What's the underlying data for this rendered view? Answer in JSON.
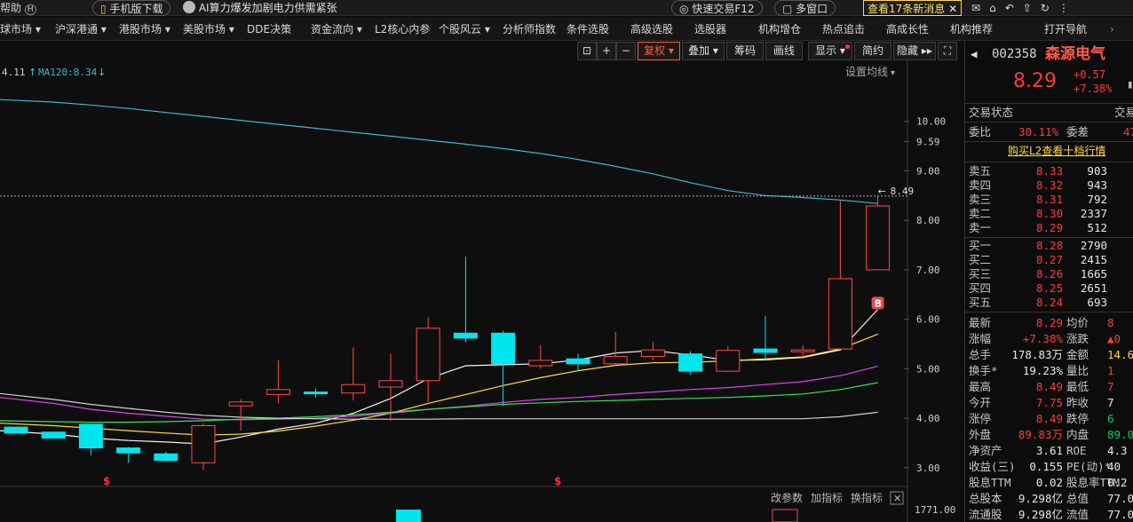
{
  "topbar": {
    "help": "帮助",
    "help_key": "H",
    "mobile": "手机版下载",
    "news": "AI算力爆发加剧电力供需紧张",
    "quick_trade": "快速交易F12",
    "multi_window": "多窗口",
    "news_count": "查看17条新消息"
  },
  "menu": [
    "球市场 ▾",
    "沪深港通 ▾",
    "港股市场 ▾",
    "美股市场 ▾",
    "DDE决策",
    "资金流向 ▾",
    "L2核心内参",
    "个股风云 ▾",
    "分析师指数",
    "条件选股",
    "高级选股",
    "选股器",
    "机构增仓",
    "热点追击",
    "高成长性",
    "机构推荐",
    "打开导航"
  ],
  "toolbar": {
    "fuquan": "复权",
    "overlay": "叠加",
    "chips": "筹码",
    "draw": "画线",
    "display": "显示",
    "simple": "简约",
    "hide": "隐藏"
  },
  "chart": {
    "ma_legend_prefix": "4.11",
    "ma120_label": "MA120:8.34",
    "settings_label": "设置均线",
    "price_ticks": [
      "10.00",
      "9.59",
      "9.00",
      "8.00",
      "7.00",
      "6.00",
      "5.00",
      "4.00",
      "3.00"
    ],
    "high_marker": "8.49",
    "buy_marker": "B",
    "div_marker": "$",
    "volume_axis": "1771.00",
    "indicator_buttons": [
      "改参数",
      "加指标",
      "换指标"
    ],
    "colors": {
      "up": "#ff4a4a",
      "down": "#00e5ee",
      "ma120": "#3fb7c9"
    }
  },
  "chart_data": {
    "type": "candlestick",
    "ylim": [
      2.8,
      10.3
    ],
    "candles": [
      {
        "o": 3.82,
        "h": 3.82,
        "l": 3.7,
        "c": 3.7
      },
      {
        "o": 3.72,
        "h": 3.72,
        "l": 3.6,
        "c": 3.6
      },
      {
        "o": 3.88,
        "h": 3.88,
        "l": 3.25,
        "c": 3.4
      },
      {
        "o": 3.4,
        "h": 3.42,
        "l": 3.1,
        "c": 3.3
      },
      {
        "o": 3.28,
        "h": 3.32,
        "l": 3.13,
        "c": 3.15
      },
      {
        "o": 3.1,
        "h": 3.9,
        "l": 2.95,
        "c": 3.85
      },
      {
        "o": 4.25,
        "h": 4.38,
        "l": 3.75,
        "c": 4.33
      },
      {
        "o": 4.48,
        "h": 5.18,
        "l": 4.3,
        "c": 4.58
      },
      {
        "o": 4.53,
        "h": 4.6,
        "l": 4.42,
        "c": 4.5
      },
      {
        "o": 4.51,
        "h": 5.43,
        "l": 4.36,
        "c": 4.68
      },
      {
        "o": 4.63,
        "h": 5.3,
        "l": 3.95,
        "c": 4.76
      },
      {
        "o": 4.76,
        "h": 6.04,
        "l": 4.33,
        "c": 5.82
      },
      {
        "o": 5.72,
        "h": 7.26,
        "l": 5.53,
        "c": 5.62
      },
      {
        "o": 5.72,
        "h": 5.77,
        "l": 4.25,
        "c": 5.1
      },
      {
        "o": 5.06,
        "h": 5.48,
        "l": 5.0,
        "c": 5.17
      },
      {
        "o": 5.2,
        "h": 5.3,
        "l": 4.95,
        "c": 5.1
      },
      {
        "o": 5.1,
        "h": 5.75,
        "l": 5.07,
        "c": 5.25
      },
      {
        "o": 5.25,
        "h": 5.55,
        "l": 5.17,
        "c": 5.38
      },
      {
        "o": 5.3,
        "h": 5.35,
        "l": 4.88,
        "c": 4.95
      },
      {
        "o": 4.95,
        "h": 5.46,
        "l": 4.93,
        "c": 5.37
      },
      {
        "o": 5.4,
        "h": 6.07,
        "l": 5.17,
        "c": 5.33
      },
      {
        "o": 5.38,
        "h": 5.47,
        "l": 5.2,
        "c": 5.38
      },
      {
        "o": 5.4,
        "h": 8.4,
        "l": 5.4,
        "c": 6.82
      },
      {
        "o": 7.0,
        "h": 8.49,
        "l": 7.0,
        "c": 8.29
      }
    ],
    "ma_lines": [
      {
        "name": "MA5",
        "color": "#f2f2f2",
        "values": [
          3.75,
          3.68,
          3.6,
          3.55,
          3.52,
          3.48,
          3.62,
          3.78,
          3.9,
          4.1,
          4.4,
          4.8,
          5.06,
          5.08,
          5.1,
          5.18,
          5.32,
          5.37,
          5.28,
          5.17,
          5.18,
          5.23,
          5.38,
          6.2
        ]
      },
      {
        "name": "MA10",
        "color": "#ffe03c",
        "values": [
          3.9,
          3.85,
          3.8,
          3.75,
          3.7,
          3.66,
          3.68,
          3.74,
          3.84,
          3.96,
          4.1,
          4.3,
          4.48,
          4.66,
          4.82,
          4.96,
          5.07,
          5.12,
          5.13,
          5.16,
          5.2,
          5.24,
          5.4,
          5.7
        ]
      },
      {
        "name": "MA20",
        "color": "#dd44ee",
        "values": [
          4.42,
          4.3,
          4.18,
          4.1,
          4.04,
          3.98,
          3.97,
          3.98,
          4.0,
          4.04,
          4.1,
          4.18,
          4.24,
          4.32,
          4.38,
          4.42,
          4.48,
          4.53,
          4.58,
          4.62,
          4.68,
          4.74,
          4.86,
          5.05
        ]
      },
      {
        "name": "MA30",
        "color": "#37e05a",
        "values": [
          3.95,
          3.93,
          3.92,
          3.92,
          3.93,
          3.95,
          3.98,
          4.0,
          4.03,
          4.07,
          4.12,
          4.18,
          4.23,
          4.28,
          4.31,
          4.34,
          4.36,
          4.38,
          4.4,
          4.42,
          4.45,
          4.49,
          4.58,
          4.72
        ]
      },
      {
        "name": "MA60",
        "color": "#d0d0d0",
        "values": [
          4.5,
          4.38,
          4.28,
          4.2,
          4.12,
          4.06,
          4.02,
          4.0,
          3.99,
          3.98,
          3.98,
          3.98,
          3.99,
          3.99,
          3.99,
          3.99,
          3.99,
          3.99,
          3.99,
          3.99,
          3.99,
          3.99,
          4.03,
          4.12
        ]
      },
      {
        "name": "MA120",
        "color": "#3fb7c9",
        "values": [
          10.44,
          10.39,
          10.33,
          10.26,
          10.18,
          10.1,
          10.02,
          9.94,
          9.86,
          9.78,
          9.7,
          9.62,
          9.54,
          9.45,
          9.35,
          9.23,
          9.09,
          8.94,
          8.76,
          8.6,
          8.5,
          8.46,
          8.41,
          8.34
        ]
      }
    ]
  },
  "quote": {
    "code": "002358",
    "name": "森源电气",
    "price": "8.29",
    "change": "+0.57",
    "change_pct": "+7.38%",
    "status_label": "交易状态",
    "status_right": "交易",
    "webi_label": "委比",
    "webi": "30.11%",
    "weicha_label": "委差",
    "weicha": "47",
    "l2_link": "购买L2查看十档行情",
    "asks": [
      {
        "label": "卖五",
        "price": "8.33",
        "vol": "903"
      },
      {
        "label": "卖四",
        "price": "8.32",
        "vol": "943"
      },
      {
        "label": "卖三",
        "price": "8.31",
        "vol": "792"
      },
      {
        "label": "卖二",
        "price": "8.30",
        "vol": "2337"
      },
      {
        "label": "卖一",
        "price": "8.29",
        "vol": "512"
      }
    ],
    "bids": [
      {
        "label": "买一",
        "price": "8.28",
        "vol": "2790"
      },
      {
        "label": "买二",
        "price": "8.27",
        "vol": "2415"
      },
      {
        "label": "买三",
        "price": "8.26",
        "vol": "1665"
      },
      {
        "label": "买四",
        "price": "8.25",
        "vol": "2651"
      },
      {
        "label": "买五",
        "price": "8.24",
        "vol": "693"
      }
    ],
    "stats": [
      {
        "l1": "最新",
        "v1": "8.29",
        "c1": "red",
        "l2": "均价",
        "v2": "8",
        "c2": "red"
      },
      {
        "l1": "涨幅",
        "v1": "+7.38%",
        "c1": "red",
        "l2": "涨跌",
        "v2": "▲0",
        "c2": "red"
      },
      {
        "l1": "总手",
        "v1": "178.83万",
        "c1": "wht",
        "l2": "金额",
        "v2": "14.6",
        "c2": "yel"
      },
      {
        "l1": "换手*",
        "v1": "19.23%",
        "c1": "wht",
        "l2": "量比",
        "v2": "1",
        "c2": "red"
      },
      {
        "l1": "最高",
        "v1": "8.49",
        "c1": "red",
        "l2": "最低",
        "v2": "7",
        "c2": "red"
      },
      {
        "l1": "今开",
        "v1": "7.75",
        "c1": "red",
        "l2": "昨收",
        "v2": "7",
        "c2": "wht"
      },
      {
        "l1": "涨停",
        "v1": "8.49",
        "c1": "red",
        "l2": "跌停",
        "v2": "6",
        "c2": "grn"
      },
      {
        "l1": "外盘",
        "v1": "89.83万",
        "c1": "red",
        "l2": "内盘",
        "v2": "89.00",
        "c2": "grn"
      },
      {
        "l1": "净资产",
        "v1": "3.61",
        "c1": "wht",
        "l2": "ROE",
        "v2": "4.3",
        "c2": "wht"
      },
      {
        "l1": "收益(三)",
        "v1": "0.155",
        "c1": "wht",
        "l2": "PE(动)*",
        "v2": "40",
        "c2": "wht"
      },
      {
        "l1": "股息TTM",
        "v1": "0.02",
        "c1": "wht",
        "l2": "股息率TTM",
        "v2": "0.2",
        "c2": "wht"
      },
      {
        "l1": "总股本",
        "v1": "9.298亿",
        "c1": "wht",
        "l2": "总值",
        "v2": "77.08",
        "c2": "wht"
      },
      {
        "l1": "流通股",
        "v1": "9.298亿",
        "c1": "wht",
        "l2": "流值",
        "v2": "77.08",
        "c2": "wht"
      }
    ]
  }
}
